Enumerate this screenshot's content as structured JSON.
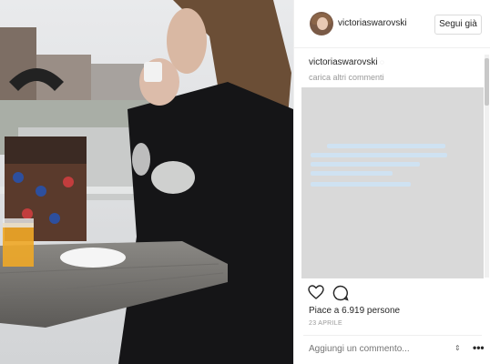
{
  "post": {
    "username": "victoriaswarovski",
    "follow_label": "Segui già",
    "caption_user": "victoriaswarovski",
    "load_more": "carica altri commenti",
    "likes": "Piace a 6.919 persone",
    "date": "23 APRILE",
    "comment_placeholder": "Aggiungi un commento..."
  },
  "icons": {
    "heart": "heart-icon",
    "comment": "comment-icon",
    "more": "more-options-icon"
  },
  "colors": {
    "text": "#262626",
    "muted": "#999999",
    "border": "#dbdbdb"
  }
}
